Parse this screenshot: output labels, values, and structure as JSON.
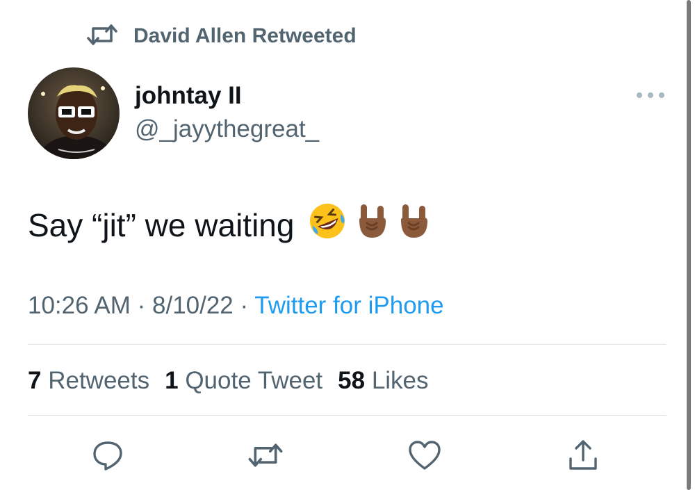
{
  "retweet_context": {
    "label": "David Allen Retweeted",
    "icon": "retweet-icon"
  },
  "author": {
    "name": "johntay II",
    "handle": "@_jayythegreat_",
    "avatar": "avatar"
  },
  "tweet": {
    "text": "Say “jit” we waiting",
    "emojis": [
      "rofl-emoji",
      "sign-of-horns-emoji",
      "sign-of-horns-emoji"
    ]
  },
  "meta": {
    "time": "10:26 AM",
    "separator": " · ",
    "date": "8/10/22",
    "source": "Twitter for iPhone"
  },
  "stats": {
    "retweets_count": "7",
    "retweets_label": "Retweets",
    "quotes_count": "1",
    "quotes_label": "Quote Tweet",
    "likes_count": "58",
    "likes_label": "Likes"
  },
  "actions": [
    "reply-icon",
    "retweet-icon",
    "like-icon",
    "share-icon"
  ],
  "colors": {
    "text": "#0f1419",
    "secondary": "#536471",
    "link": "#1d9bf0",
    "divider": "#dfe3e6"
  }
}
